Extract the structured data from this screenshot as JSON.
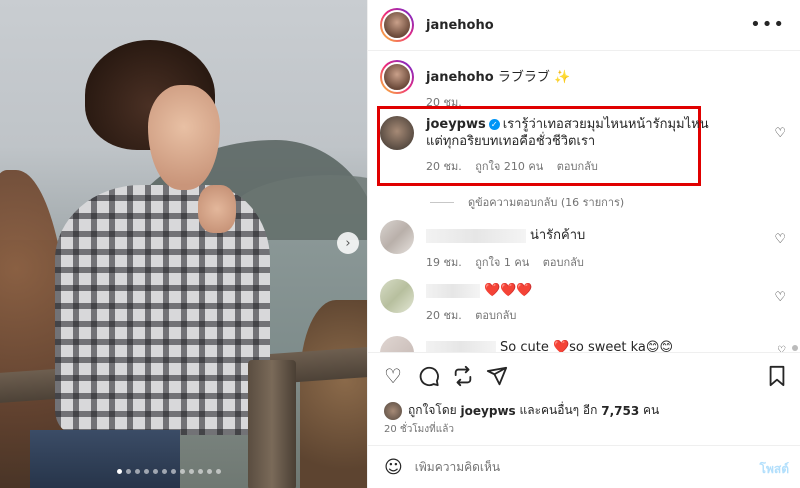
{
  "post": {
    "author": "janehoho",
    "more_icon": "more-horizontal-icon",
    "carousel": {
      "dot_count": 12,
      "active_index": 0,
      "next_icon": "chevron-right-icon"
    }
  },
  "caption": {
    "username": "janehoho",
    "text": "ラブラブ ✨",
    "time": "20 ชม."
  },
  "highlighted_comment": {
    "username": "joeypws",
    "verified": true,
    "line1": "เรารู้ว่าเทอสวยมุมไหนหน้ารักมุมไหน",
    "line2": "แต่ทุกอริยบทเทอคือชั่วชีวิตเรา",
    "time": "20 ชม.",
    "likes": "ถูกใจ 210 คน",
    "reply": "ตอบกลับ",
    "highlight_color": "#e00000"
  },
  "view_replies": "ดูข้อความตอบกลับ (16 รายการ)",
  "comments": [
    {
      "text": "น่ารักค้าบ",
      "time": "19 ชม.",
      "likes": "ถูกใจ 1 คน",
      "reply": "ตอบกลับ"
    },
    {
      "text": "❤️❤️❤️",
      "time": "20 ชม.",
      "likes": "",
      "reply": "ตอบกลับ"
    },
    {
      "text": "So cute ❤️so sweet ka😊😊",
      "time": "",
      "likes": "",
      "reply": ""
    }
  ],
  "actions": {
    "like_icon": "heart-icon",
    "comment_icon": "comment-icon",
    "share_icon": "repost-icon",
    "send_icon": "send-icon",
    "save_icon": "bookmark-icon"
  },
  "liked_by": {
    "prefix": "ถูกใจโดย",
    "user": "joeypws",
    "middle": "และคนอื่นๆ อีก",
    "count": "7,753",
    "suffix": "คน"
  },
  "posted_ago": "20 ชั่วโมงที่แล้ว",
  "add_comment": {
    "placeholder": "เพิ่มความคิดเห็น",
    "post_label": "โพสต์",
    "emoji_icon": "emoji-icon"
  }
}
